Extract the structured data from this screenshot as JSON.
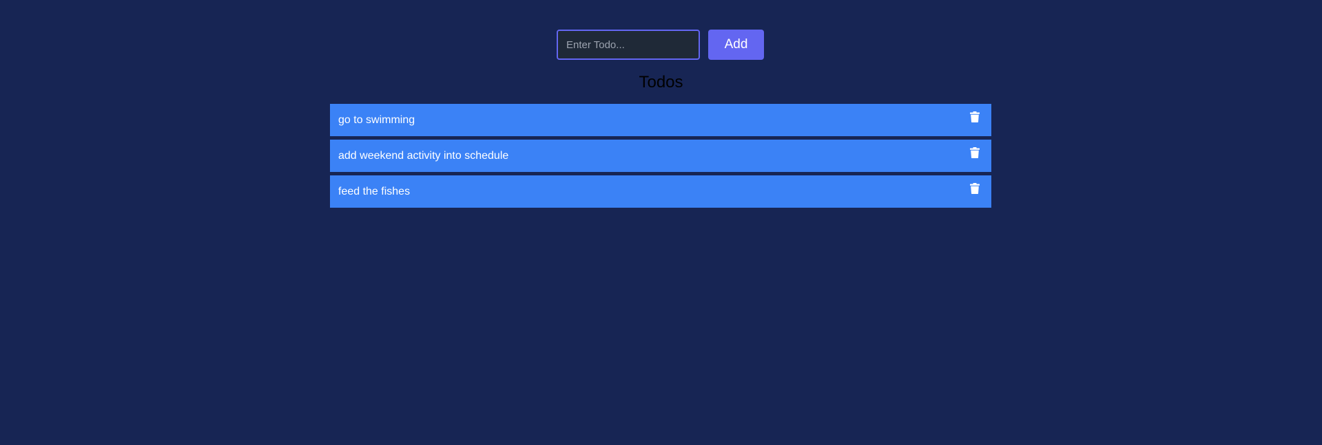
{
  "form": {
    "input_value": "",
    "input_placeholder": "Enter Todo...",
    "add_label": "Add"
  },
  "todos": {
    "title": "Todos",
    "items": [
      {
        "text": "go to swimming",
        "action_icon": "trash-icon"
      },
      {
        "text": "add weekend activity into schedule",
        "action_icon": "trash-icon"
      },
      {
        "text": "feed the fishes",
        "action_icon": "trash-icon"
      }
    ]
  },
  "colors": {
    "background": "#172554",
    "input_bg": "#1f2937",
    "accent": "#6366f1",
    "item_bg": "#3b82f6",
    "text_light": "#ffffff"
  }
}
